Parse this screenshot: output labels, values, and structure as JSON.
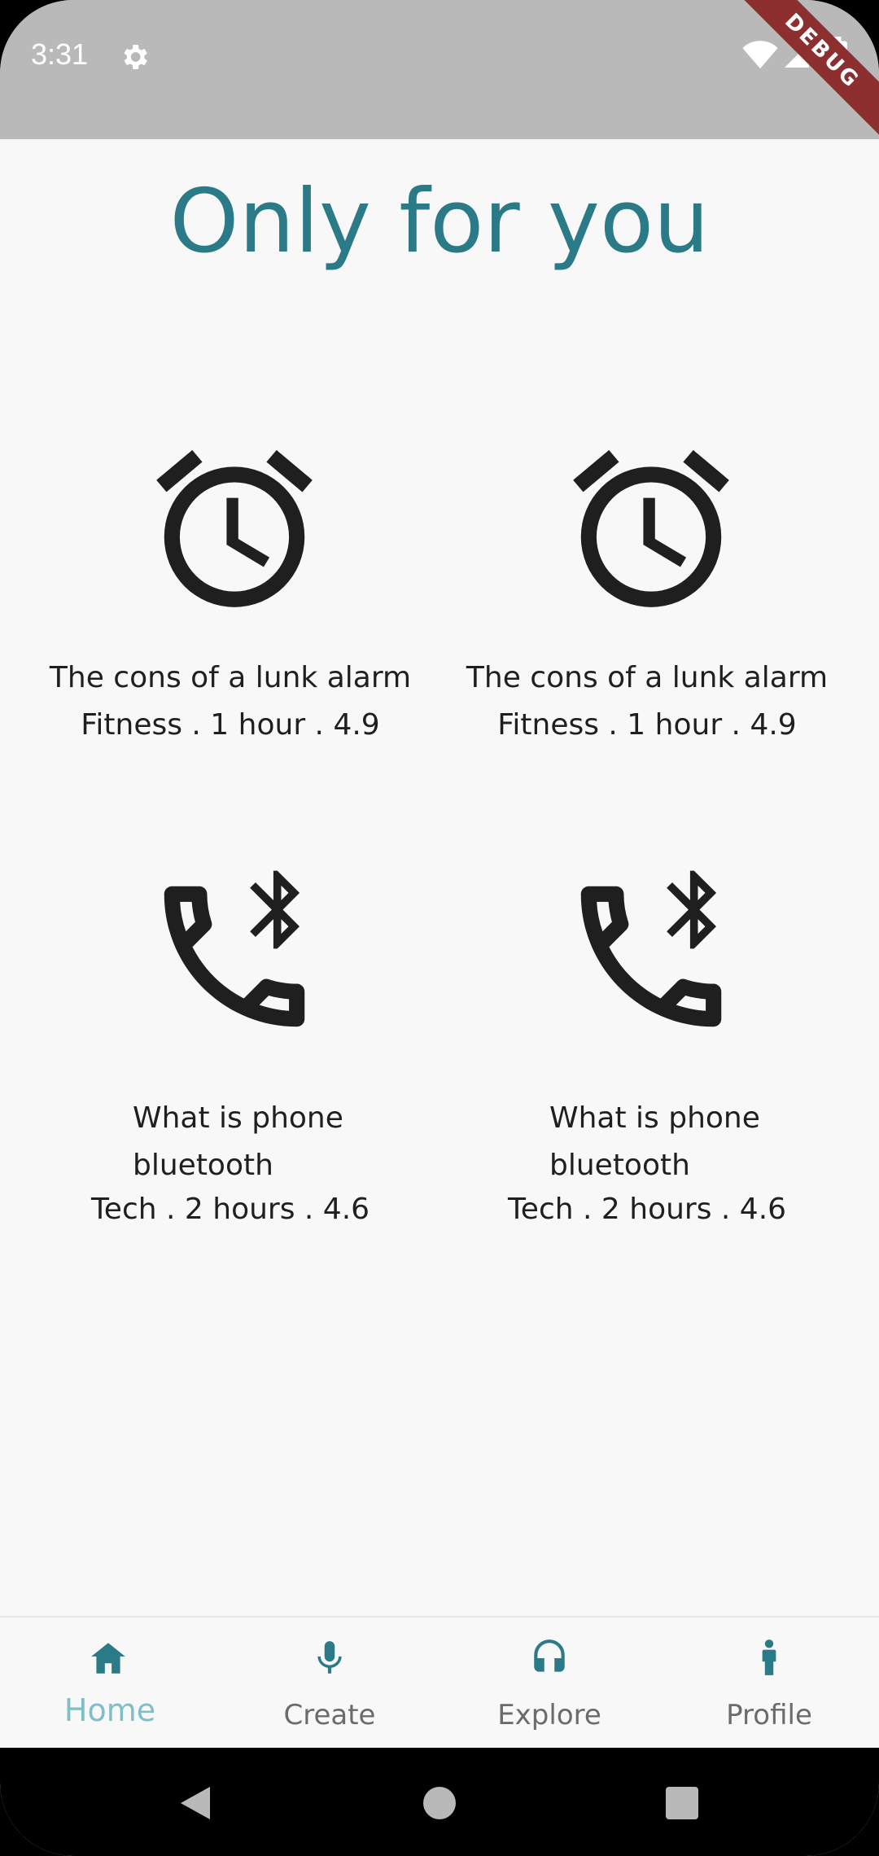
{
  "status": {
    "time": "3:31",
    "debug_label": "DEBUG"
  },
  "page": {
    "title": "Only for you"
  },
  "cards": [
    {
      "icon": "alarm-clock-icon",
      "title": "The cons of a lunk alarm",
      "meta": "Fitness . 1 hour . 4.9"
    },
    {
      "icon": "alarm-clock-icon",
      "title": "The cons of a lunk alarm",
      "meta": "Fitness . 1 hour . 4.9"
    },
    {
      "icon": "phone-bluetooth-icon",
      "title_line1": "What is phone",
      "title_line2": "bluetooth",
      "meta": "Tech . 2 hours . 4.6"
    },
    {
      "icon": "phone-bluetooth-icon",
      "title_line1": "What is phone",
      "title_line2": "bluetooth",
      "meta": "Tech . 2 hours . 4.6"
    }
  ],
  "bottom_nav": {
    "items": [
      {
        "label": "Home",
        "icon": "home-icon",
        "active": true
      },
      {
        "label": "Create",
        "icon": "microphone-icon",
        "active": false
      },
      {
        "label": "Explore",
        "icon": "headphones-icon",
        "active": false
      },
      {
        "label": "Profile",
        "icon": "person-icon",
        "active": false
      }
    ]
  },
  "colors": {
    "accent": "#2b7a87",
    "accent_light": "#7fbfc8",
    "status_bar": "#b9b9b9",
    "background": "#f8f8f8",
    "debug_ribbon": "#8e2f2f"
  }
}
